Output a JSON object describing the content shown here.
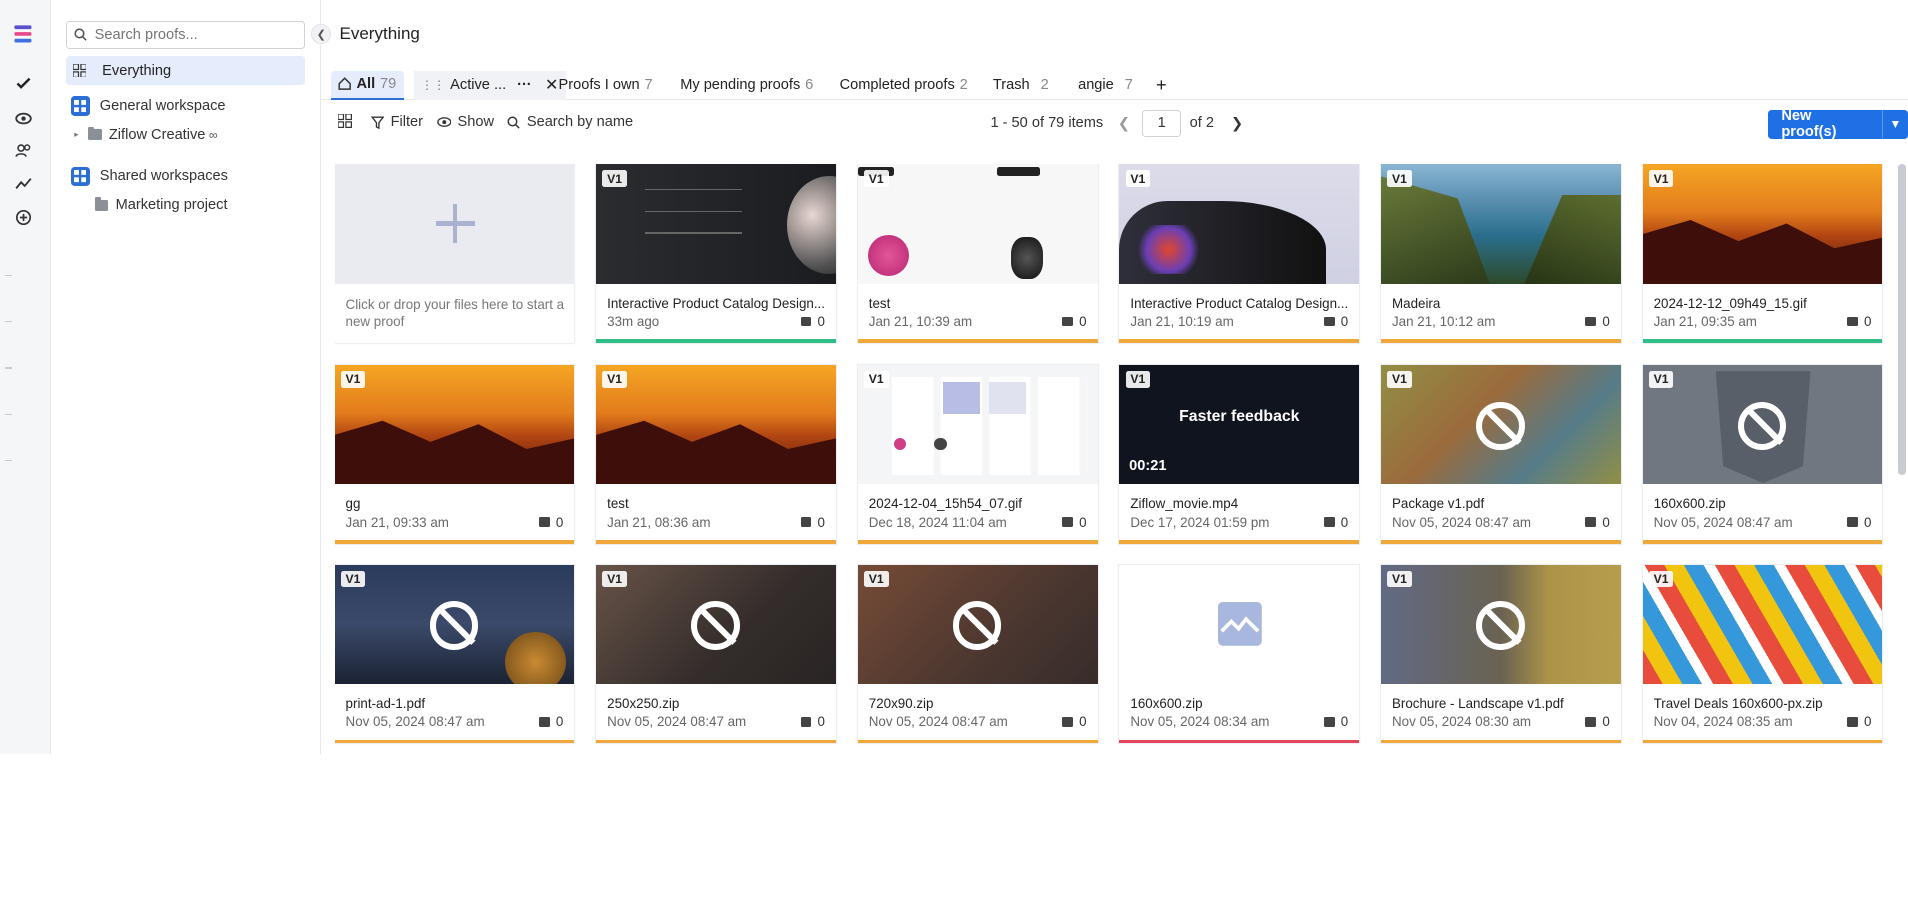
{
  "colors": {
    "accent": "#1f6fe5",
    "green": "#2fbf86",
    "orange": "#f0a83a",
    "red": "#e2445c",
    "selected_bg": "#e5ecfb"
  },
  "sidebar": {
    "search_placeholder": "Search proofs...",
    "everything_label": "Everything",
    "general_workspace": "General workspace",
    "ziflow_creative": "Ziflow Creative",
    "shared_workspaces": "Shared workspaces",
    "marketing_project": "Marketing project"
  },
  "header": {
    "title": "Everything"
  },
  "tabs": [
    {
      "label": "All",
      "count": "79"
    },
    {
      "label": "Active ..."
    },
    {
      "label": "Proofs I own",
      "count": "7"
    },
    {
      "label": "My pending proofs",
      "count": "6"
    },
    {
      "label": "Completed proofs",
      "count": "2"
    },
    {
      "label": "Trash",
      "count": "2"
    },
    {
      "label": "angie",
      "count": "7"
    }
  ],
  "toolbar": {
    "filter": "Filter",
    "show": "Show",
    "search_by_name": "Search by name",
    "items_range": "1 - 50 of 79 items",
    "page_value": "1",
    "of_pages": "of 2",
    "new_proofs": "New proof(s)"
  },
  "drop_text": "Click or drop your files here to start a new proof",
  "cards": [
    {
      "name": "Interactive Product Catalog Design...",
      "date": "33m ago",
      "comments": "0",
      "version": "V1",
      "status_color": "#2fbf86"
    },
    {
      "name": "test",
      "date": "Jan 21, 10:39 am",
      "comments": "0",
      "version": "V1",
      "status_color": "#f0a83a"
    },
    {
      "name": "Interactive Product Catalog Design...",
      "date": "Jan 21, 10:19 am",
      "comments": "0",
      "version": "V1",
      "status_color": "#f0a83a"
    },
    {
      "name": "Madeira",
      "date": "Jan 21, 10:12 am",
      "comments": "0",
      "version": "V1",
      "status_color": "#f0a83a"
    },
    {
      "name": "2024-12-12_09h49_15.gif",
      "date": "Jan 21, 09:35 am",
      "comments": "0",
      "version": "V1",
      "status_color": "#2fbf86"
    },
    {
      "name": "gg",
      "date": "Jan 21, 09:33 am",
      "comments": "0",
      "version": "V1",
      "status_color": "#f0a83a"
    },
    {
      "name": "test",
      "date": "Jan 21, 08:36 am",
      "comments": "0",
      "version": "V1",
      "status_color": "#f0a83a"
    },
    {
      "name": "2024-12-04_15h54_07.gif",
      "date": "Dec 18, 2024 11:04 am",
      "comments": "0",
      "version": "V1",
      "status_color": "#f0a83a"
    },
    {
      "name": "Ziflow_movie.mp4",
      "date": "Dec 17, 2024 01:59 pm",
      "comments": "0",
      "version": "V1",
      "status_color": "#f0a83a",
      "overlay_text": "Faster feedback",
      "duration": "00:21"
    },
    {
      "name": "Package v1.pdf",
      "date": "Nov 05, 2024 08:47 am",
      "comments": "0",
      "version": "V1",
      "status_color": "#f0a83a"
    },
    {
      "name": "160x600.zip",
      "date": "Nov 05, 2024 08:47 am",
      "comments": "0",
      "version": "V1",
      "status_color": "#f0a83a"
    },
    {
      "name": "print-ad-1.pdf",
      "date": "Nov 05, 2024 08:47 am",
      "comments": "0",
      "version": "V1",
      "status_color": "#f0a83a"
    },
    {
      "name": "250x250.zip",
      "date": "Nov 05, 2024 08:47 am",
      "comments": "0",
      "version": "V1",
      "status_color": "#f0a83a"
    },
    {
      "name": "720x90.zip",
      "date": "Nov 05, 2024 08:47 am",
      "comments": "0",
      "version": "V1",
      "status_color": "#f0a83a"
    },
    {
      "name": "160x600.zip",
      "date": "Nov 05, 2024 08:34 am",
      "comments": "0",
      "version": "",
      "status_color": "#e2445c"
    },
    {
      "name": "Brochure - Landscape v1.pdf",
      "date": "Nov 05, 2024 08:30 am",
      "comments": "0",
      "version": "V1",
      "status_color": "#f0a83a"
    },
    {
      "name": "Travel Deals 160x600-px.zip",
      "date": "Nov 04, 2024 08:35 am",
      "comments": "0",
      "version": "V1",
      "status_color": "#f0a83a"
    }
  ]
}
